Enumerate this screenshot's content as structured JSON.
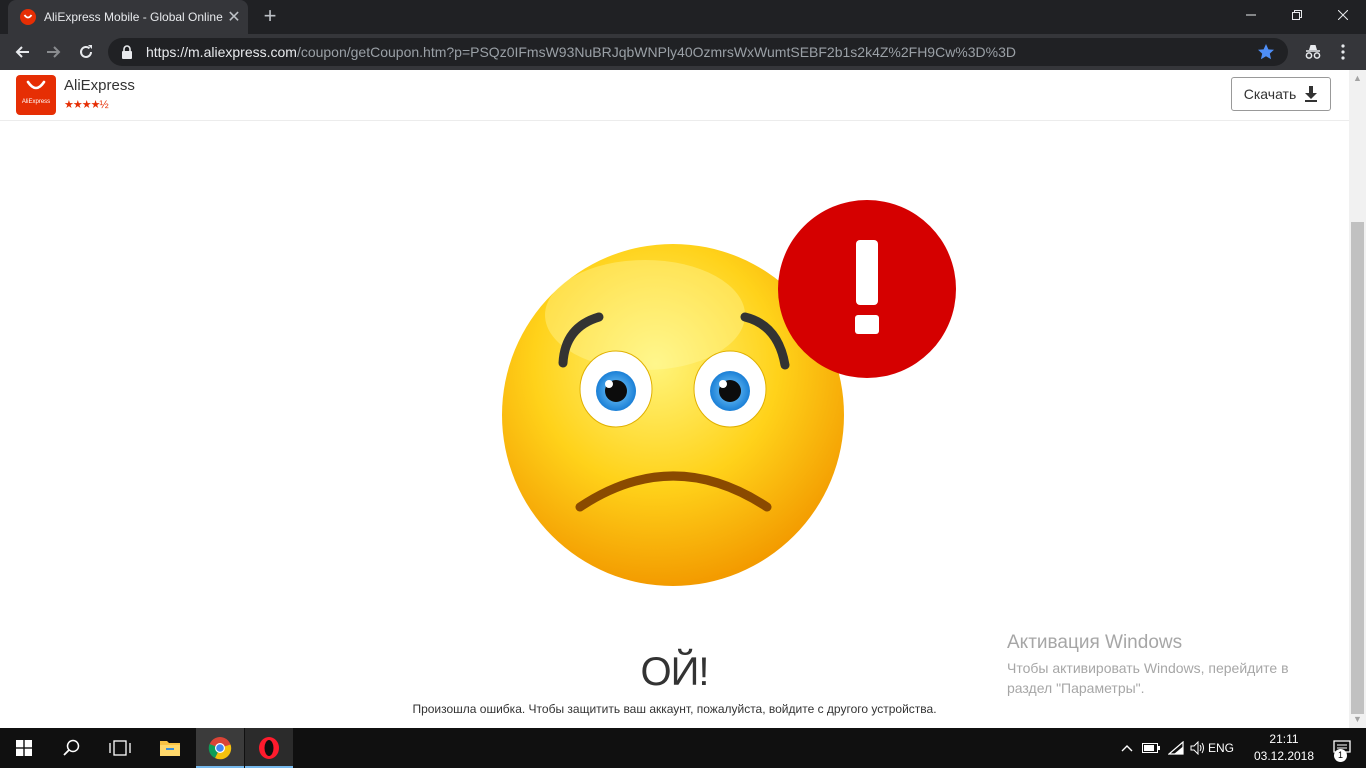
{
  "browser": {
    "tab_title": "AliExpress Mobile - Global Online Shopping",
    "tab_close": "✕",
    "new_tab": "+",
    "url_host": "https://m.aliexpress.com",
    "url_path": "/coupon/getCoupon.htm?p=PSQz0IFmsW93NuBRJqbWNPly40OzmrsWxWumtSEBF2b1s2k4Z%2FH9Cw%3D%3D"
  },
  "app_banner": {
    "logo_caption": "AliExpress",
    "app_name": "AliExpress",
    "stars_text": "★★★★½",
    "rating": 4.5,
    "download_label": "Скачать"
  },
  "main": {
    "heading": "ОЙ!",
    "message": "Произошла ошибка. Чтобы защитить ваш аккаунт, пожалуйста, войдите с другого устройства."
  },
  "watermark": {
    "title": "Активация Windows",
    "line1": "Чтобы активировать Windows, перейдите в",
    "line2": "раздел \"Параметры\"."
  },
  "taskbar": {
    "language": "ENG",
    "time": "21:11",
    "date": "03.12.2018",
    "notification_count": "1"
  },
  "colors": {
    "brand": "#e62e04",
    "alert_red": "#d50000",
    "chrome_dark": "#202124",
    "chrome_toolbar": "#35363a",
    "star_blue": "#4e8ef7"
  }
}
